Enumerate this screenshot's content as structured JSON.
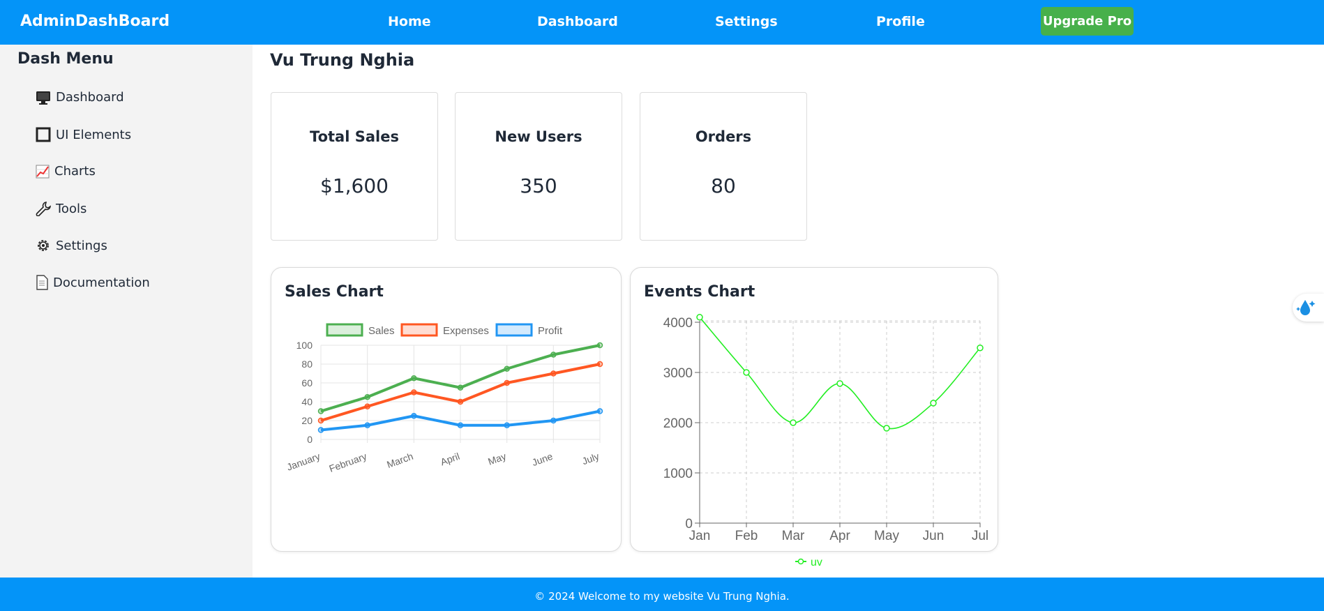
{
  "header": {
    "brand": "AdminDashBoard",
    "nav": [
      "Home",
      "Dashboard",
      "Settings",
      "Profile"
    ],
    "upgrade_label": "Upgrade Pro"
  },
  "sidebar": {
    "title": "Dash Menu",
    "items": [
      {
        "label": "Dashboard",
        "icon": "monitor-icon"
      },
      {
        "label": "UI Elements",
        "icon": "square-icon"
      },
      {
        "label": "Charts",
        "icon": "chart-icon"
      },
      {
        "label": "Tools",
        "icon": "wrench-icon"
      },
      {
        "label": "Settings",
        "icon": "gear-icon"
      },
      {
        "label": "Documentation",
        "icon": "document-icon"
      }
    ]
  },
  "main": {
    "user_name": "Vu Trung Nghia",
    "stats": [
      {
        "title": "Total Sales",
        "value": "$1,600"
      },
      {
        "title": "New Users",
        "value": "350"
      },
      {
        "title": "Orders",
        "value": "80"
      }
    ]
  },
  "chart_data": [
    {
      "type": "line",
      "title": "Sales Chart",
      "categories": [
        "January",
        "February",
        "March",
        "April",
        "May",
        "June",
        "July"
      ],
      "series": [
        {
          "name": "Sales",
          "values": [
            30,
            45,
            65,
            55,
            75,
            90,
            100
          ],
          "color": "#4caf50"
        },
        {
          "name": "Expenses",
          "values": [
            20,
            35,
            50,
            40,
            60,
            70,
            80
          ],
          "color": "#ff5722"
        },
        {
          "name": "Profit",
          "values": [
            10,
            15,
            25,
            15,
            15,
            20,
            30
          ],
          "color": "#2196f3"
        }
      ],
      "ylim": [
        0,
        100
      ],
      "yticks": [
        0,
        20,
        40,
        60,
        80,
        100
      ],
      "grid": true,
      "legend": "top"
    },
    {
      "type": "line",
      "title": "Events Chart",
      "categories": [
        "Jan",
        "Feb",
        "Mar",
        "Apr",
        "May",
        "Jun",
        "Jul"
      ],
      "series": [
        {
          "name": "uv",
          "values": [
            4100,
            3000,
            2000,
            2780,
            1890,
            2390,
            3490
          ],
          "color": "#22ee22"
        }
      ],
      "ylim": [
        0,
        4000
      ],
      "yticks": [
        0,
        1000,
        2000,
        3000,
        4000
      ],
      "grid": true,
      "legend": "bottom"
    }
  ],
  "footer": {
    "text": "© 2024 Welcome to my website Vu Trung Nghia."
  }
}
